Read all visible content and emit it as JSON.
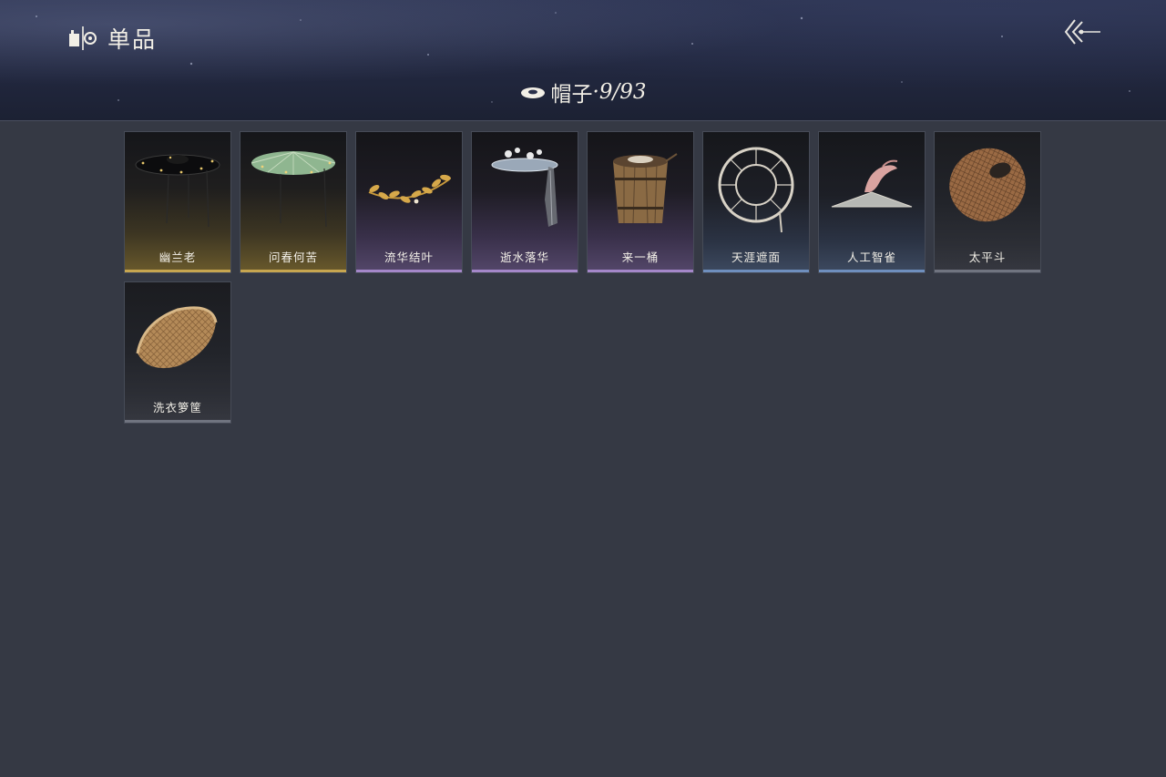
{
  "header": {
    "brand_icon": "collection-icon",
    "title": "单品",
    "back_icon": "back-arrow-icon"
  },
  "category": {
    "icon": "hat-icon",
    "name": "帽子",
    "separator": "·",
    "count": "9/93"
  },
  "items": [
    {
      "name": "幽兰老",
      "rarity": "gold",
      "icon": "black-straw-hat-icon"
    },
    {
      "name": "问春何苦",
      "rarity": "gold",
      "icon": "green-straw-hat-icon"
    },
    {
      "name": "流华结叶",
      "rarity": "purple",
      "icon": "golden-laurel-icon"
    },
    {
      "name": "逝水落华",
      "rarity": "purple",
      "icon": "veiled-hat-icon"
    },
    {
      "name": "来一桶",
      "rarity": "purple",
      "icon": "wooden-bucket-icon"
    },
    {
      "name": "天涯遮面",
      "rarity": "blue",
      "icon": "open-frame-hat-icon"
    },
    {
      "name": "人工智雀",
      "rarity": "blue",
      "icon": "bird-hat-icon"
    },
    {
      "name": "太平斗",
      "rarity": "gray",
      "icon": "woven-basket-hat-icon"
    },
    {
      "name": "洗衣箩筐",
      "rarity": "gray",
      "icon": "laundry-basket-icon"
    }
  ],
  "colors": {
    "background": "#353944",
    "gold": "#c7a650",
    "purple": "#a487c9",
    "blue": "#6f8fbe",
    "gray": "#707480"
  }
}
